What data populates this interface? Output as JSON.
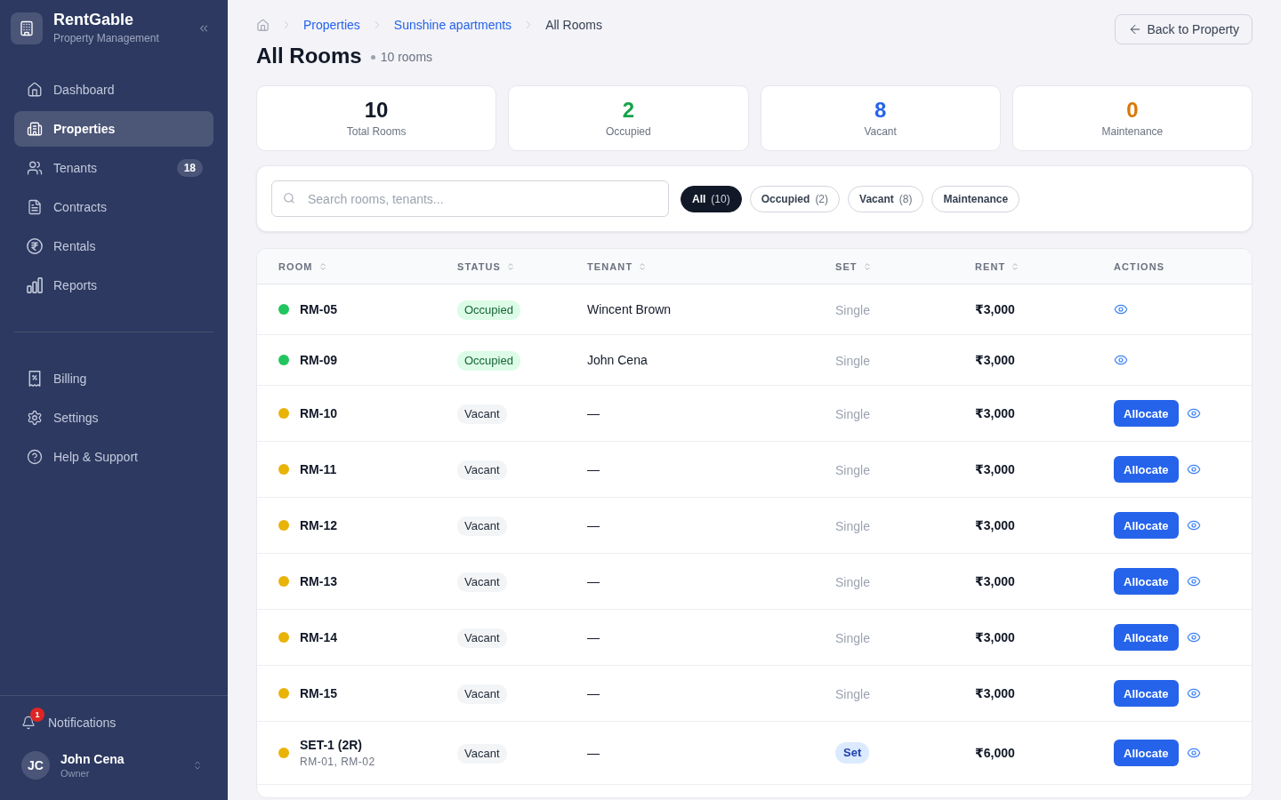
{
  "sidebar": {
    "brand": {
      "name": "RentGable",
      "tagline": "Property Management"
    },
    "nav_main": [
      {
        "label": "Dashboard",
        "selected": false
      },
      {
        "label": "Properties",
        "selected": true
      },
      {
        "label": "Tenants",
        "selected": false,
        "badge": "18"
      },
      {
        "label": "Contracts",
        "selected": false
      },
      {
        "label": "Rentals",
        "selected": false
      },
      {
        "label": "Reports",
        "selected": false
      }
    ],
    "nav_secondary": [
      {
        "label": "Billing",
        "selected": false
      },
      {
        "label": "Settings",
        "selected": false
      },
      {
        "label": "Help & Support",
        "selected": false
      }
    ],
    "notifications": {
      "label": "Notifications",
      "badge": "1"
    },
    "user": {
      "initials": "JC",
      "name": "John Cena",
      "role": "Owner"
    }
  },
  "breadcrumb": {
    "links": [
      "Properties",
      "Sunshine apartments"
    ],
    "current": "All Rooms"
  },
  "back_button": {
    "label": "Back to Property"
  },
  "page": {
    "title": "All Rooms",
    "count": "10 rooms"
  },
  "stats": [
    {
      "value": "10",
      "label": "Total Rooms",
      "color": "#111827"
    },
    {
      "value": "2",
      "label": "Occupied",
      "color": "#16a34a"
    },
    {
      "value": "8",
      "label": "Vacant",
      "color": "#2563eb"
    },
    {
      "value": "0",
      "label": "Maintenance",
      "color": "#d97706"
    }
  ],
  "filters": {
    "search": {
      "placeholder": "Search rooms, tenants..."
    },
    "chips": [
      {
        "label": "All",
        "count": "(10)",
        "selected": true
      },
      {
        "label": "Occupied",
        "count": "(2)",
        "selected": false
      },
      {
        "label": "Vacant",
        "count": "(8)",
        "selected": false
      },
      {
        "label": "Maintenance",
        "selected": false
      }
    ]
  },
  "table": {
    "columns": [
      {
        "label": "ROOM",
        "sortable": true
      },
      {
        "label": "STATUS",
        "sortable": true
      },
      {
        "label": "TENANT",
        "sortable": true
      },
      {
        "label": "SET",
        "sortable": true
      },
      {
        "label": "RENT",
        "sortable": true
      },
      {
        "label": "ACTIONS",
        "sortable": false
      }
    ],
    "rows": [
      {
        "room": "RM-05",
        "color": "#22c55e",
        "status": {
          "label": "Occupied",
          "kind": "occupied"
        },
        "tenant": "Wincent Brown",
        "set": {
          "label": "Single",
          "kind": "plain"
        },
        "rent": "₹3,000",
        "actions": [
          {
            "kind": "view"
          }
        ]
      },
      {
        "room": "RM-09",
        "color": "#22c55e",
        "status": {
          "label": "Occupied",
          "kind": "occupied"
        },
        "tenant": "John Cena",
        "set": {
          "label": "Single",
          "kind": "plain"
        },
        "rent": "₹3,000",
        "actions": [
          {
            "kind": "view"
          }
        ]
      },
      {
        "room": "RM-10",
        "color": "#eab308",
        "status": {
          "label": "Vacant",
          "kind": "vacant"
        },
        "tenant": "—",
        "set": {
          "label": "Single",
          "kind": "plain"
        },
        "rent": "₹3,000",
        "actions": [
          {
            "kind": "allocate",
            "label": "Allocate"
          },
          {
            "kind": "view"
          }
        ]
      },
      {
        "room": "RM-11",
        "color": "#eab308",
        "status": {
          "label": "Vacant",
          "kind": "vacant"
        },
        "tenant": "—",
        "set": {
          "label": "Single",
          "kind": "plain"
        },
        "rent": "₹3,000",
        "actions": [
          {
            "kind": "allocate",
            "label": "Allocate"
          },
          {
            "kind": "view"
          }
        ]
      },
      {
        "room": "RM-12",
        "color": "#eab308",
        "status": {
          "label": "Vacant",
          "kind": "vacant"
        },
        "tenant": "—",
        "set": {
          "label": "Single",
          "kind": "plain"
        },
        "rent": "₹3,000",
        "actions": [
          {
            "kind": "allocate",
            "label": "Allocate"
          },
          {
            "kind": "view"
          }
        ]
      },
      {
        "room": "RM-13",
        "color": "#eab308",
        "status": {
          "label": "Vacant",
          "kind": "vacant"
        },
        "tenant": "—",
        "set": {
          "label": "Single",
          "kind": "plain"
        },
        "rent": "₹3,000",
        "actions": [
          {
            "kind": "allocate",
            "label": "Allocate"
          },
          {
            "kind": "view"
          }
        ]
      },
      {
        "room": "RM-14",
        "color": "#eab308",
        "status": {
          "label": "Vacant",
          "kind": "vacant"
        },
        "tenant": "—",
        "set": {
          "label": "Single",
          "kind": "plain"
        },
        "rent": "₹3,000",
        "actions": [
          {
            "kind": "allocate",
            "label": "Allocate"
          },
          {
            "kind": "view"
          }
        ]
      },
      {
        "room": "RM-15",
        "color": "#eab308",
        "status": {
          "label": "Vacant",
          "kind": "vacant"
        },
        "tenant": "—",
        "set": {
          "label": "Single",
          "kind": "plain"
        },
        "rent": "₹3,000",
        "actions": [
          {
            "kind": "allocate",
            "label": "Allocate"
          },
          {
            "kind": "view"
          }
        ]
      },
      {
        "room": "SET-1 (2R)",
        "rooms": "RM-01, RM-02",
        "color": "#eab308",
        "status": {
          "label": "Vacant",
          "kind": "vacant"
        },
        "tenant": "—",
        "set": {
          "label": "Set",
          "kind": "tag"
        },
        "rent": "₹6,000",
        "actions": [
          {
            "kind": "allocate",
            "label": "Allocate"
          },
          {
            "kind": "view"
          }
        ]
      }
    ]
  }
}
